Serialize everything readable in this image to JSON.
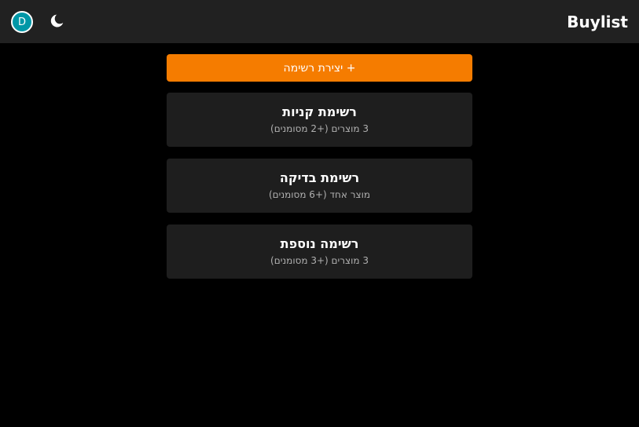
{
  "header": {
    "title": "Buylist",
    "avatar_letter": "D",
    "theme_icon": "moon-icon"
  },
  "colors": {
    "accent": "#f57c00",
    "avatar": "#0097a7",
    "header_bg": "#212121",
    "card_bg": "#1e1e1e",
    "page_bg": "#000000"
  },
  "main": {
    "create_label": "+ יצירת רשימה",
    "lists": [
      {
        "title": "רשימת קניות",
        "subtitle": "3 מוצרים (+2 מסומנים)"
      },
      {
        "title": "רשימת בדיקה",
        "subtitle": "מוצר אחד (+6 מסומנים)"
      },
      {
        "title": "רשימה נוספת",
        "subtitle": "3 מוצרים (+3 מסומנים)"
      }
    ]
  }
}
